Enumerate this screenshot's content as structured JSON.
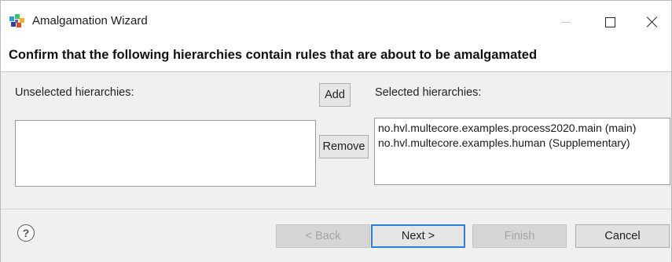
{
  "window": {
    "title": "Amalgamation Wizard",
    "icon": "eclipse-wizard-icon"
  },
  "header": {
    "message": "Confirm that the following hierarchies contain rules that are about to be amalgamated"
  },
  "unselected": {
    "label": "Unselected hierarchies:",
    "items": []
  },
  "selected": {
    "label": "Selected hierarchies:",
    "items": [
      "no.hvl.multecore.examples.process2020.main (main)",
      "no.hvl.multecore.examples.human (Supplementary)"
    ]
  },
  "buttons": {
    "add": "Add",
    "remove": "Remove",
    "back": "< Back",
    "next": "Next >",
    "finish": "Finish",
    "cancel": "Cancel",
    "help": "?"
  },
  "colors": {
    "default_button_border": "#2f7fd6",
    "dialog_background": "#f0f0f0"
  }
}
